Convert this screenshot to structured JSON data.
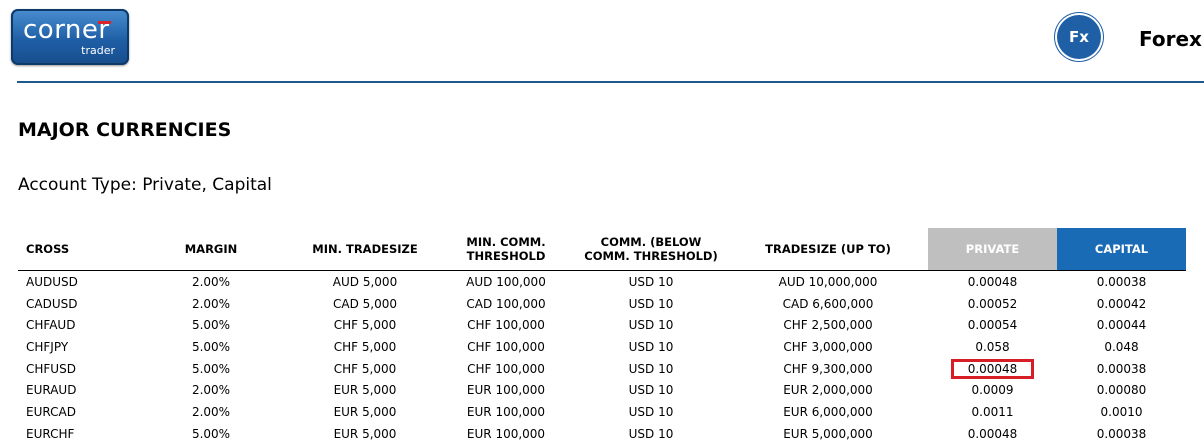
{
  "logo": {
    "word": "corner",
    "sub": "trader"
  },
  "header": {
    "badge": "Fx",
    "section": "Forex"
  },
  "page_title": "MAJOR CURRENCIES",
  "account_type": "Account Type: Private, Capital",
  "colors": {
    "accent": "#1a6bb5",
    "private_header": "#bfbfbf",
    "highlight": "#d61f26"
  },
  "table": {
    "columns": [
      "CROSS",
      "MARGIN",
      "MIN. TRADESIZE",
      "MIN. COMM.\nTHRESHOLD",
      "COMM. (BELOW\nCOMM. THRESHOLD)",
      "TRADESIZE (UP TO)",
      "PRIVATE",
      "CAPITAL"
    ],
    "rows": [
      [
        "AUDUSD",
        "2.00%",
        "AUD 5,000",
        "AUD 100,000",
        "USD 10",
        "AUD 10,000,000",
        "0.00048",
        "0.00038"
      ],
      [
        "CADUSD",
        "2.00%",
        "CAD 5,000",
        "CAD 100,000",
        "USD 10",
        "CAD 6,600,000",
        "0.00052",
        "0.00042"
      ],
      [
        "CHFAUD",
        "5.00%",
        "CHF 5,000",
        "CHF 100,000",
        "USD 10",
        "CHF 2,500,000",
        "0.00054",
        "0.00044"
      ],
      [
        "CHFJPY",
        "5.00%",
        "CHF 5,000",
        "CHF 100,000",
        "USD 10",
        "CHF 3,000,000",
        "0.058",
        "0.048"
      ],
      [
        "CHFUSD",
        "5.00%",
        "CHF 5,000",
        "CHF 100,000",
        "USD 10",
        "CHF 9,300,000",
        "0.00048",
        "0.00038"
      ],
      [
        "EURAUD",
        "2.00%",
        "EUR 5,000",
        "EUR 100,000",
        "USD 10",
        "EUR 2,000,000",
        "0.0009",
        "0.00080"
      ],
      [
        "EURCAD",
        "2.00%",
        "EUR 5,000",
        "EUR 100,000",
        "USD 10",
        "EUR 6,000,000",
        "0.0011",
        "0.0010"
      ],
      [
        "EURCHF",
        "5.00%",
        "EUR 5,000",
        "EUR 100,000",
        "USD 10",
        "EUR 5,000,000",
        "0.00048",
        "0.00038"
      ]
    ],
    "highlighted_cell": {
      "row": 4,
      "col": 6
    }
  }
}
